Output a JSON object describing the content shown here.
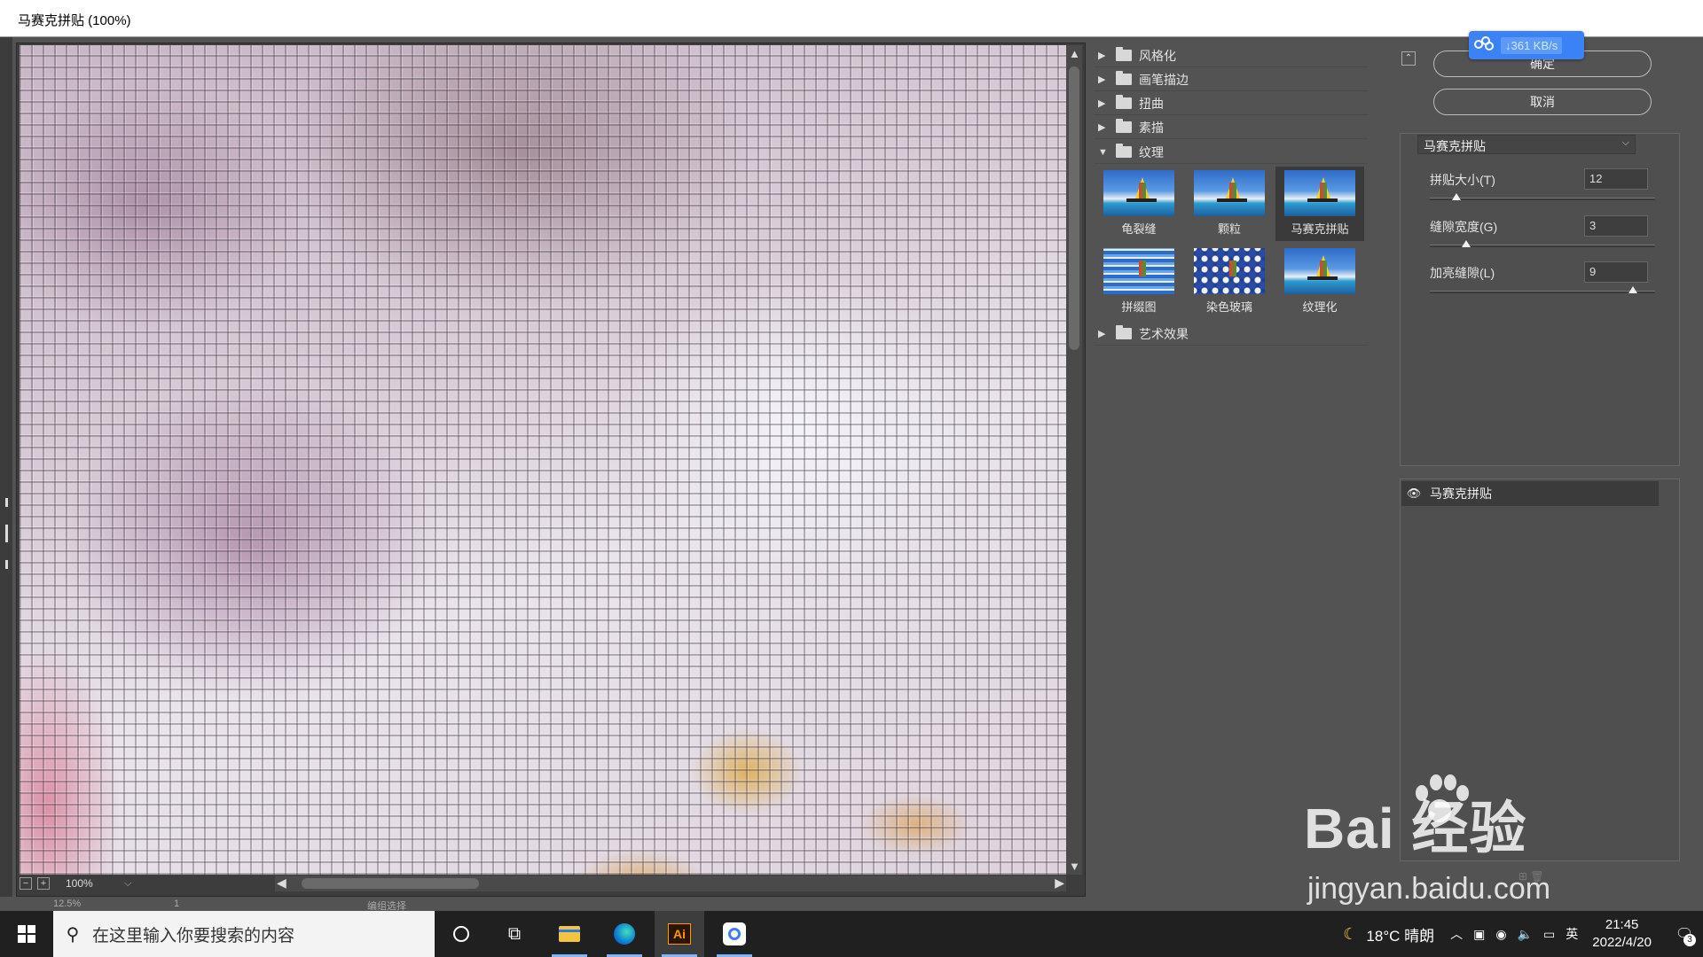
{
  "window": {
    "title": "马赛克拼贴 (100%)"
  },
  "preview": {
    "zoom": "100%",
    "zoom_out": "−",
    "zoom_in": "+",
    "zoom_dropdown": "⌵",
    "scroll_up": "▲",
    "scroll_down": "▼",
    "scroll_left": "◀",
    "scroll_right": "▶"
  },
  "gallery": {
    "categories": [
      {
        "label": "风格化",
        "expanded": false
      },
      {
        "label": "画笔描边",
        "expanded": false
      },
      {
        "label": "扭曲",
        "expanded": false
      },
      {
        "label": "素描",
        "expanded": false
      },
      {
        "label": "纹理",
        "expanded": true
      },
      {
        "label": "艺术效果",
        "expanded": false
      }
    ],
    "collapsed_arrow": "▶",
    "expanded_arrow": "▼",
    "texture_filters": [
      {
        "label": "龟裂缝",
        "selected": false
      },
      {
        "label": "颗粒",
        "selected": false
      },
      {
        "label": "马赛克拼贴",
        "selected": true
      },
      {
        "label": "拼缀图",
        "selected": false
      },
      {
        "label": "染色玻璃",
        "selected": false
      },
      {
        "label": "纹理化",
        "selected": false
      }
    ]
  },
  "actions": {
    "ok_label": "确定",
    "cancel_label": "取消",
    "collapse_icon": "⌃"
  },
  "net_badge": {
    "speed": "↓361 KB/s"
  },
  "settings": {
    "filter_select": "马赛克拼贴",
    "select_chevron": "⌵",
    "params": [
      {
        "label": "拼贴大小(T)",
        "value": "12",
        "level": 0.12
      },
      {
        "label": "缝隙宽度(G)",
        "value": "3",
        "level": 0.16
      },
      {
        "label": "加亮缝隙(L)",
        "value": "9",
        "level": 0.9
      }
    ]
  },
  "layers": {
    "items": [
      {
        "name": "马赛克拼贴",
        "visible": true
      }
    ],
    "eye_icon": "👁",
    "tools": "⊞ 🗑"
  },
  "under_strip": {
    "zoom": "12.5%",
    "page": "1",
    "mode": "编组选择"
  },
  "taskbar": {
    "search_placeholder": "在这里输入你要搜索的内容",
    "search_icon": "⚲",
    "task_view_icon": "⧉",
    "ai_label": "Ai",
    "weather": "18°C 晴朗",
    "moon_icon": "☾",
    "tray_up": "︿",
    "ime": "英",
    "time": "21:45",
    "date": "2022/4/20",
    "notification_icon": "🗨",
    "notification_count": "3"
  },
  "watermark": {
    "brand": "Bai  经验",
    "url": "jingyan.baidu.com"
  }
}
